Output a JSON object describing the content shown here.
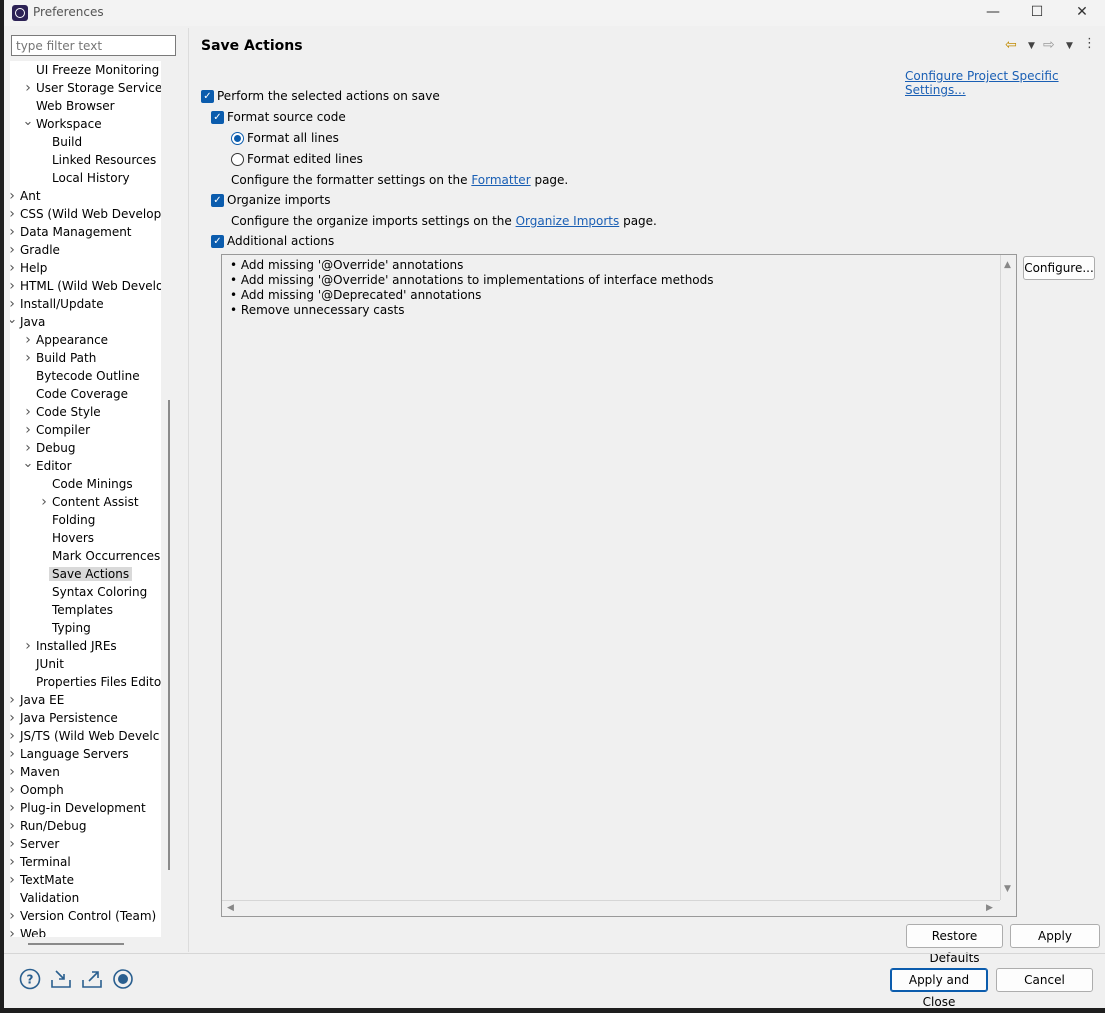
{
  "window": {
    "title": "Preferences",
    "minimize": "—",
    "maximize": "☐",
    "close": "✕"
  },
  "filter": {
    "placeholder": "type filter text"
  },
  "tree": [
    {
      "label": "UI Freeze Monitoring",
      "level": 2,
      "chevron": ""
    },
    {
      "label": "User Storage Service",
      "level": 2,
      "chevron": ">"
    },
    {
      "label": "Web Browser",
      "level": 2,
      "chevron": ""
    },
    {
      "label": "Workspace",
      "level": 2,
      "chevron": "v"
    },
    {
      "label": "Build",
      "level": 3,
      "chevron": ""
    },
    {
      "label": "Linked Resources",
      "level": 3,
      "chevron": ""
    },
    {
      "label": "Local History",
      "level": 3,
      "chevron": ""
    },
    {
      "label": "Ant",
      "level": 1,
      "chevron": ">"
    },
    {
      "label": "CSS (Wild Web Develop",
      "level": 1,
      "chevron": ">"
    },
    {
      "label": "Data Management",
      "level": 1,
      "chevron": ">"
    },
    {
      "label": "Gradle",
      "level": 1,
      "chevron": ">"
    },
    {
      "label": "Help",
      "level": 1,
      "chevron": ">"
    },
    {
      "label": "HTML (Wild Web Develo",
      "level": 1,
      "chevron": ">"
    },
    {
      "label": "Install/Update",
      "level": 1,
      "chevron": ">"
    },
    {
      "label": "Java",
      "level": 1,
      "chevron": "v"
    },
    {
      "label": "Appearance",
      "level": 2,
      "chevron": ">"
    },
    {
      "label": "Build Path",
      "level": 2,
      "chevron": ">"
    },
    {
      "label": "Bytecode Outline",
      "level": 2,
      "chevron": ""
    },
    {
      "label": "Code Coverage",
      "level": 2,
      "chevron": ""
    },
    {
      "label": "Code Style",
      "level": 2,
      "chevron": ">"
    },
    {
      "label": "Compiler",
      "level": 2,
      "chevron": ">"
    },
    {
      "label": "Debug",
      "level": 2,
      "chevron": ">"
    },
    {
      "label": "Editor",
      "level": 2,
      "chevron": "v"
    },
    {
      "label": "Code Minings",
      "level": 3,
      "chevron": ""
    },
    {
      "label": "Content Assist",
      "level": 3,
      "chevron": ">"
    },
    {
      "label": "Folding",
      "level": 3,
      "chevron": ""
    },
    {
      "label": "Hovers",
      "level": 3,
      "chevron": ""
    },
    {
      "label": "Mark Occurrences",
      "level": 3,
      "chevron": ""
    },
    {
      "label": "Save Actions",
      "level": 3,
      "chevron": "",
      "selected": true
    },
    {
      "label": "Syntax Coloring",
      "level": 3,
      "chevron": ""
    },
    {
      "label": "Templates",
      "level": 3,
      "chevron": ""
    },
    {
      "label": "Typing",
      "level": 3,
      "chevron": ""
    },
    {
      "label": "Installed JREs",
      "level": 2,
      "chevron": ">"
    },
    {
      "label": "JUnit",
      "level": 2,
      "chevron": ""
    },
    {
      "label": "Properties Files Edito",
      "level": 2,
      "chevron": ""
    },
    {
      "label": "Java EE",
      "level": 1,
      "chevron": ">"
    },
    {
      "label": "Java Persistence",
      "level": 1,
      "chevron": ">"
    },
    {
      "label": "JS/TS (Wild Web Develc",
      "level": 1,
      "chevron": ">"
    },
    {
      "label": "Language Servers",
      "level": 1,
      "chevron": ">"
    },
    {
      "label": "Maven",
      "level": 1,
      "chevron": ">"
    },
    {
      "label": "Oomph",
      "level": 1,
      "chevron": ">"
    },
    {
      "label": "Plug-in Development",
      "level": 1,
      "chevron": ">"
    },
    {
      "label": "Run/Debug",
      "level": 1,
      "chevron": ">"
    },
    {
      "label": "Server",
      "level": 1,
      "chevron": ">"
    },
    {
      "label": "Terminal",
      "level": 1,
      "chevron": ">"
    },
    {
      "label": "TextMate",
      "level": 1,
      "chevron": ">"
    },
    {
      "label": "Validation",
      "level": 1,
      "chevron": ""
    },
    {
      "label": "Version Control (Team)",
      "level": 1,
      "chevron": ">"
    },
    {
      "label": "Web",
      "level": 1,
      "chevron": ">"
    }
  ],
  "page": {
    "title": "Save Actions",
    "configure_project_link": "Configure Project Specific Settings...",
    "perform_label": "Perform the selected actions on save",
    "format_source_label": "Format source code",
    "format_all_label": "Format all lines",
    "format_edited_label": "Format edited lines",
    "formatter_prefix": "Configure the formatter settings on the",
    "formatter_link": "Formatter",
    "formatter_suffix": "page.",
    "organize_label": "Organize imports",
    "organize_prefix": "Configure the organize imports settings on the",
    "organize_link": "Organize Imports",
    "organize_suffix": "page.",
    "additional_label": "Additional actions",
    "additional_items": [
      "Add missing '@Override' annotations",
      "Add missing '@Override' annotations to implementations of interface methods",
      "Add missing '@Deprecated' annotations",
      "Remove unnecessary casts"
    ],
    "configure_button": "Configure...",
    "restore_defaults": "Restore Defaults",
    "apply": "Apply"
  },
  "footer": {
    "apply_and_close": "Apply and Close",
    "cancel": "Cancel"
  },
  "colors": {
    "accent": "#0b5cad",
    "link": "#1a5fb4",
    "selection": "#d9d9d9"
  },
  "icons": [
    "help-icon",
    "import-icon",
    "export-icon",
    "record-icon"
  ]
}
